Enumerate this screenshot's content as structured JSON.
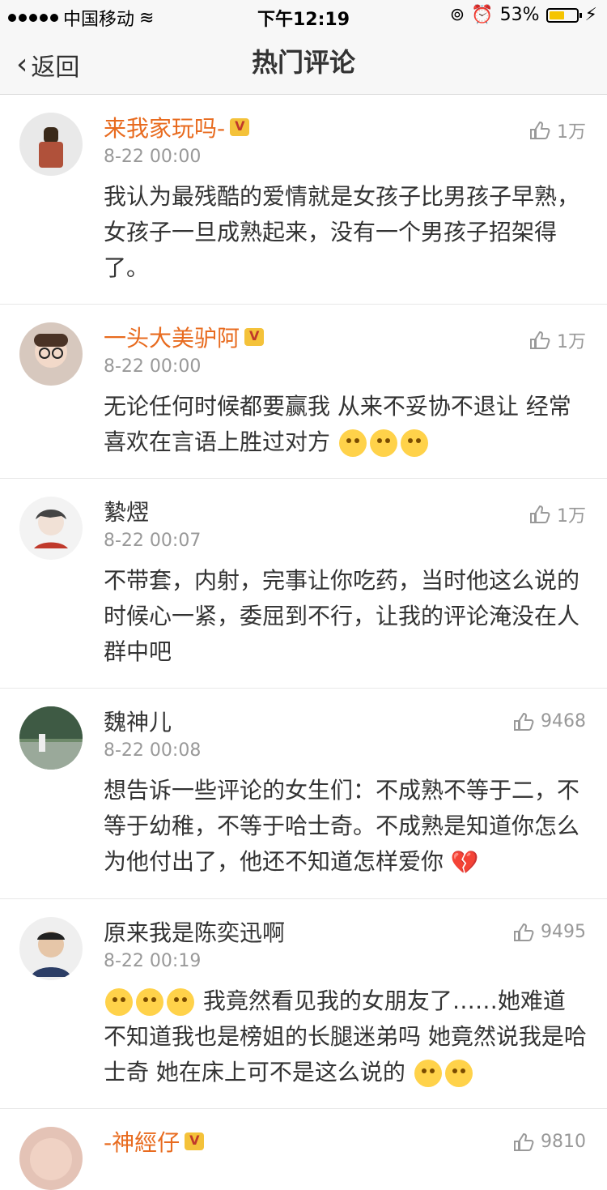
{
  "status": {
    "carrier": "中国移动",
    "time": "下午12:19",
    "battery": "53%"
  },
  "nav": {
    "back_label": "返回",
    "title": "热门评论"
  },
  "comments": [
    {
      "name": "来我家玩吗-",
      "time": "8-22 00:00",
      "likes": "1万",
      "text": "我认为最残酷的爱情就是女孩子比男孩子早熟，女孩子一旦成熟起来，没有一个男孩子招架得了。",
      "vip": true
    },
    {
      "name": "一头大美驴阿",
      "time": "8-22 00:00",
      "likes": "1万",
      "text": "无论任何时候都要赢我 从来不妥协不退让 经常喜欢在言语上胜过对方",
      "vip": true
    },
    {
      "name": "縶熤",
      "time": "8-22 00:07",
      "likes": "1万",
      "text": "不带套，内射，完事让你吃药，当时他这么说的时候心一紧，委屈到不行，让我的评论淹没在人群中吧",
      "vip": false
    },
    {
      "name": "魏神儿",
      "time": "8-22 00:08",
      "likes": "9468",
      "text": "想告诉一些评论的女生们：不成熟不等于二，不等于幼稚，不等于哈士奇。不成熟是知道你怎么为他付出了，他还不知道怎样爱你",
      "vip": false
    },
    {
      "name": "原来我是陈奕迅啊",
      "time": "8-22 00:19",
      "likes": "9495",
      "text": "我竟然看见我的女朋友了……她难道不知道我也是榜姐的长腿迷弟吗 她竟然说我是哈士奇 她在床上可不是这么说的",
      "vip": false
    },
    {
      "name": "-神經仔",
      "time": "",
      "likes": "9810",
      "text": "",
      "vip": true
    }
  ]
}
